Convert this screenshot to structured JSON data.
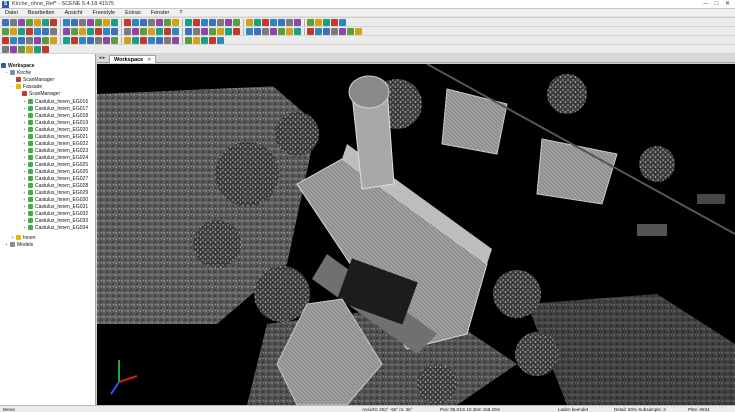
{
  "window": {
    "title": "Kirche_ohne_Ref* - SCENE 5.4.18.41575",
    "controls": [
      "─",
      "□",
      "✕"
    ]
  },
  "menu": [
    "Datei",
    "Bearbeiten",
    "Ansicht",
    "Freestyle",
    "Extras",
    "Fenster",
    "?"
  ],
  "tree": {
    "workspace": "Workspace",
    "kirche": "Kirche",
    "scanmanager": "ScanManager",
    "fassade": "Fassade",
    "fassade_scanmanager": "ScanManager",
    "scans": [
      "Castulus_Innen_EG016",
      "Castulus_Innen_EG017",
      "Castulus_Innen_EG018",
      "Castulus_Innen_EG019",
      "Castulus_Innen_EG020",
      "Castulus_Innen_EG021",
      "Castulus_Innen_EG022",
      "Castulus_Innen_EG023",
      "Castulus_Innen_EG024",
      "Castulus_Innen_EG025",
      "Castulus_Innen_EG026",
      "Castulus_Innen_EG027",
      "Castulus_Innen_EG028",
      "Castulus_Innen_EG029",
      "Castulus_Innen_EG030",
      "Castulus_Innen_EG031",
      "Castulus_Innen_EG032",
      "Castulus_Innen_EG033",
      "Castulus_Innen_EG034"
    ],
    "innen": "Innen",
    "models": "Models"
  },
  "tab": {
    "label": "Workspace",
    "nav": "◂ ▸",
    "close": "✕"
  },
  "status": {
    "ready": "Bereit",
    "view": "Ansicht: 252° -56° m: 36°",
    "position": "Pos: 95.01m 19.36m 168.20m",
    "loading": "Laden beendet",
    "detail": "Detail:  50%  Subsample:  2",
    "fps": "Pkte: 6934"
  },
  "colors": {
    "accent": "#2a5aa8",
    "scan_icon": "#3cb043",
    "folder": "#e6b800"
  }
}
